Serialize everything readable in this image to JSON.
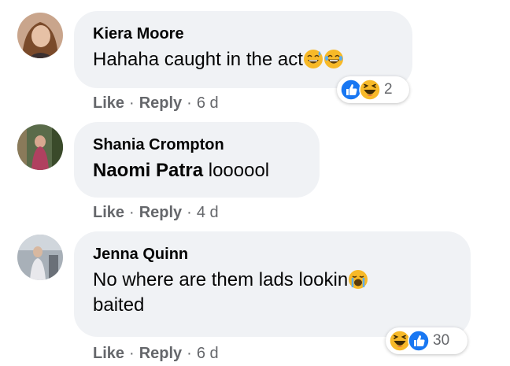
{
  "comments": [
    {
      "author": "Kiera Moore",
      "text": "Hahaha caught in the act",
      "like": "Like",
      "reply": "Reply",
      "time": "6 d",
      "reaction_count": "2"
    },
    {
      "author": "Shania Crompton",
      "mention": "Naomi Patra",
      "text": " loooool",
      "like": "Like",
      "reply": "Reply",
      "time": "4 d"
    },
    {
      "author": "Jenna Quinn",
      "text_line1": "No where are them lads lookin",
      "text_line2": "baited",
      "like": "Like",
      "reply": "Reply",
      "time": "6 d",
      "reaction_count": "30"
    }
  ],
  "separator": "·",
  "colors": {
    "bubble": "#f0f2f5",
    "meta_text": "#65676b",
    "like_blue": "#1877f2",
    "haha_yellow": "#f7b125"
  }
}
